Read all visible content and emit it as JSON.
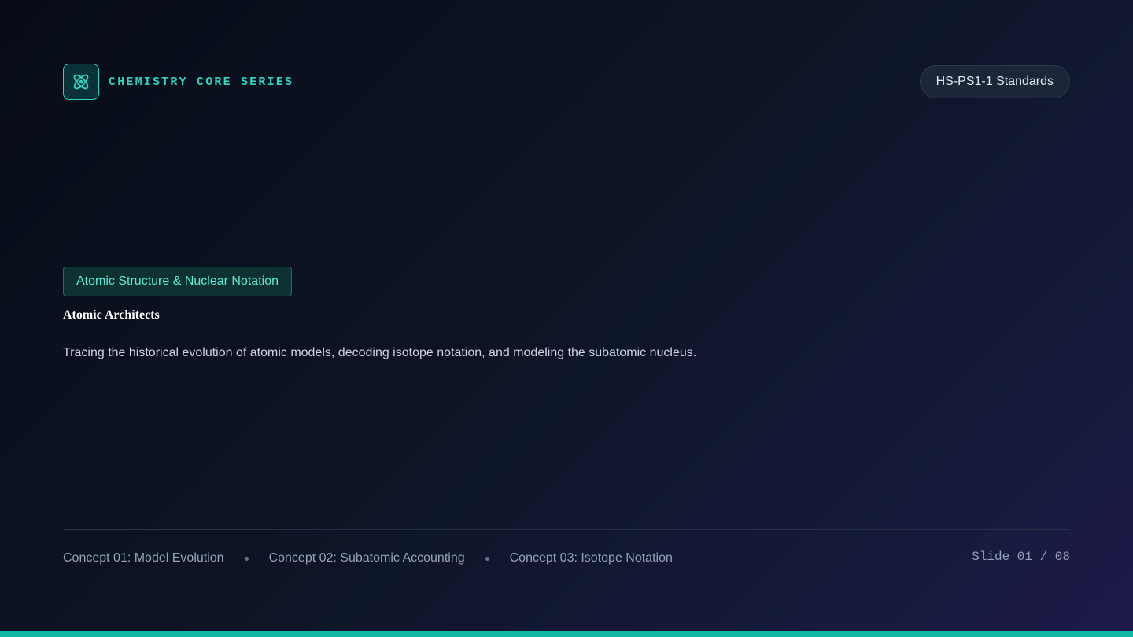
{
  "header": {
    "brand_name": "CHEMISTRY CORE SERIES",
    "brand_icon": "atom-icon",
    "standards_label": "HS-PS1-1 Standards"
  },
  "hero": {
    "topic_chip": "Atomic Structure & Nuclear Notation",
    "title": "Atomic Architects",
    "subtitle": "Tracing the historical evolution of atomic models, decoding isotope notation, and modeling the subatomic nucleus."
  },
  "footer": {
    "concepts": [
      "Concept 01: Model Evolution",
      "Concept 02: Subatomic Accounting",
      "Concept 03: Isotope Notation"
    ],
    "slide_counter": "Slide 01 / 08"
  },
  "colors": {
    "accent": "#2dd4bf",
    "bottom_bar": "#14b8a6",
    "background": "#0b1220"
  }
}
